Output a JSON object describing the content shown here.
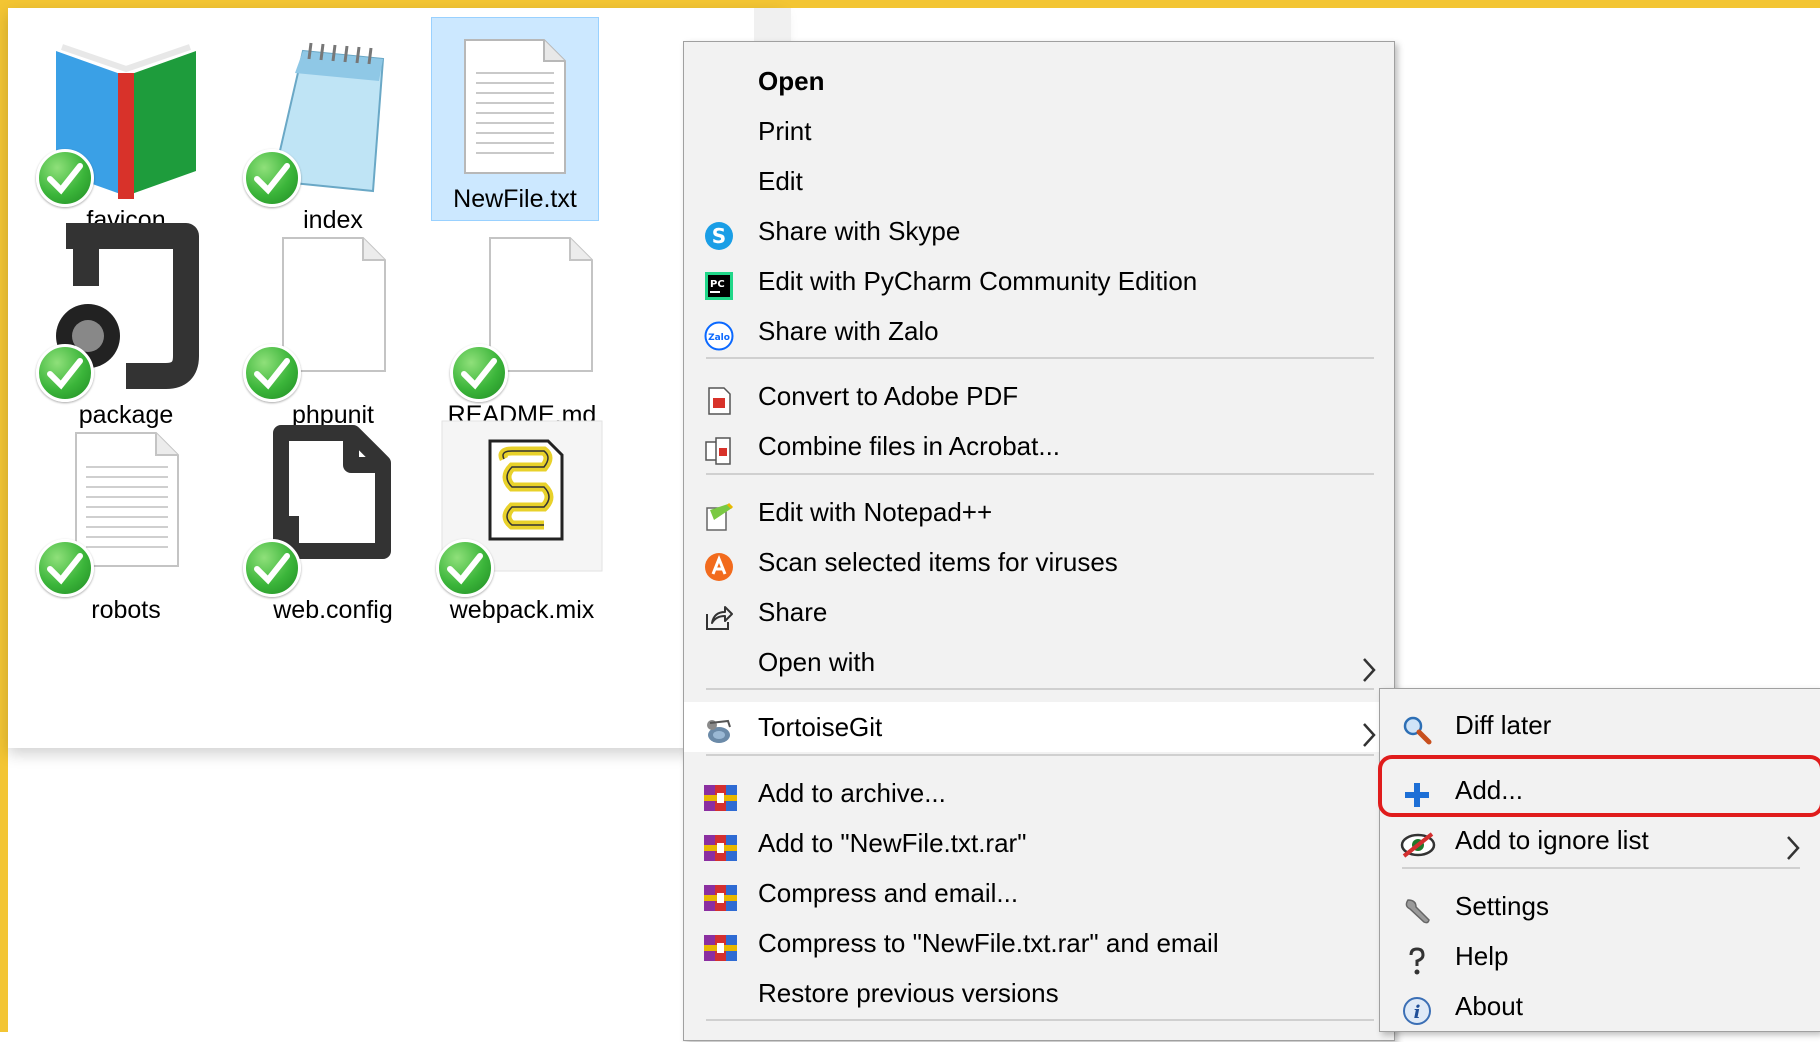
{
  "files": [
    {
      "name": "favicon",
      "icon": "book-icon"
    },
    {
      "name": "index",
      "icon": "notepad-icon"
    },
    {
      "name": "NewFile.txt",
      "icon": "text-file-icon",
      "selected": true
    },
    {
      "name": "package",
      "icon": "json-file-icon"
    },
    {
      "name": "phpunit",
      "icon": "blank-file-icon"
    },
    {
      "name": "README.md",
      "icon": "blank-file-icon"
    },
    {
      "name": "robots",
      "icon": "text-file-icon"
    },
    {
      "name": "web.config",
      "icon": "config-file-icon"
    },
    {
      "name": "webpack.mix",
      "icon": "script-file-icon"
    }
  ],
  "context_menu": {
    "items": [
      {
        "label": "Open",
        "bold": true
      },
      {
        "label": "Print"
      },
      {
        "label": "Edit"
      },
      {
        "label": "Share with Skype",
        "icon": "skype-icon"
      },
      {
        "label": "Edit with PyCharm Community Edition",
        "icon": "pycharm-icon"
      },
      {
        "label": "Share with Zalo",
        "icon": "zalo-icon"
      },
      {
        "label": "Convert to Adobe PDF",
        "icon": "adobe-pdf-icon"
      },
      {
        "label": "Combine files in Acrobat...",
        "icon": "acrobat-combine-icon"
      },
      {
        "label": "Edit with Notepad++",
        "icon": "notepadpp-icon"
      },
      {
        "label": "Scan selected items for viruses",
        "icon": "avast-icon"
      },
      {
        "label": "Share",
        "icon": "share-icon"
      },
      {
        "label": "Open with",
        "submenu": true
      },
      {
        "label": "TortoiseGit",
        "icon": "tortoisegit-icon",
        "submenu": true,
        "hover": true
      },
      {
        "label": "Add to archive...",
        "icon": "winrar-icon"
      },
      {
        "label": "Add to \"NewFile.txt.rar\"",
        "icon": "winrar-icon"
      },
      {
        "label": "Compress and email...",
        "icon": "winrar-icon"
      },
      {
        "label": "Compress to \"NewFile.txt.rar\" and email",
        "icon": "winrar-icon"
      },
      {
        "label": "Restore previous versions"
      }
    ]
  },
  "submenu": {
    "items": [
      {
        "label": "Diff later",
        "icon": "magnifier-icon"
      },
      {
        "label": "Add...",
        "icon": "plus-icon",
        "highlighted": true
      },
      {
        "label": "Add to ignore list",
        "icon": "ignore-icon",
        "submenu": true
      },
      {
        "label": "Settings",
        "icon": "wrench-icon"
      },
      {
        "label": "Help",
        "icon": "help-icon"
      },
      {
        "label": "About",
        "icon": "info-icon"
      }
    ]
  },
  "colors": {
    "frame": "#f3c533",
    "selection": "#cce8ff",
    "menu_bg": "#f2f2f2",
    "highlight": "#e01c1c",
    "check_green": "#3bb53a"
  }
}
